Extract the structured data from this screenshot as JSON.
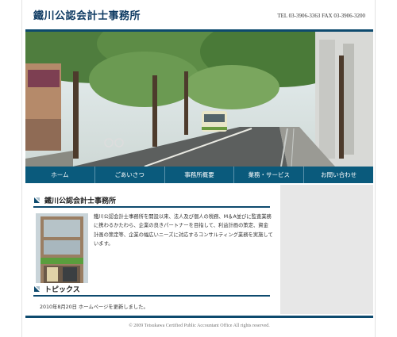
{
  "header": {
    "site_title": "鐵川公認会計士事務所",
    "contact": "TEL 03-3906-3363 FAX 03-3906-3200"
  },
  "colors": {
    "accent": "#0d4a6e",
    "nav": "#0a5a7c",
    "sidebar": "#e7e7e7"
  },
  "nav": {
    "items": [
      {
        "label": "ホーム"
      },
      {
        "label": "ごあいさつ"
      },
      {
        "label": "事務所概要"
      },
      {
        "label": "業務・サービス"
      },
      {
        "label": "お問い合わせ"
      }
    ]
  },
  "main": {
    "intro_heading": "鐵川公認会計士事務所",
    "intro_text": "鐵川公認会計士事務所を開設以来、法人及び個人の税務、M＆A並びに監査業務に携わるかたわら、企業の良きパートナーを目指して、利益計画の策定、資金計画の策定等、企業の幅広いニーズに対応するコンサルティング業務を実施しています。",
    "topics_heading": "トピックス",
    "topic_item": "2010年8月20日 ホームページを更新しました。"
  },
  "footer": {
    "copyright": "© 2009 Tetsukawa Certified Public Accountant Office All rights reserved."
  }
}
